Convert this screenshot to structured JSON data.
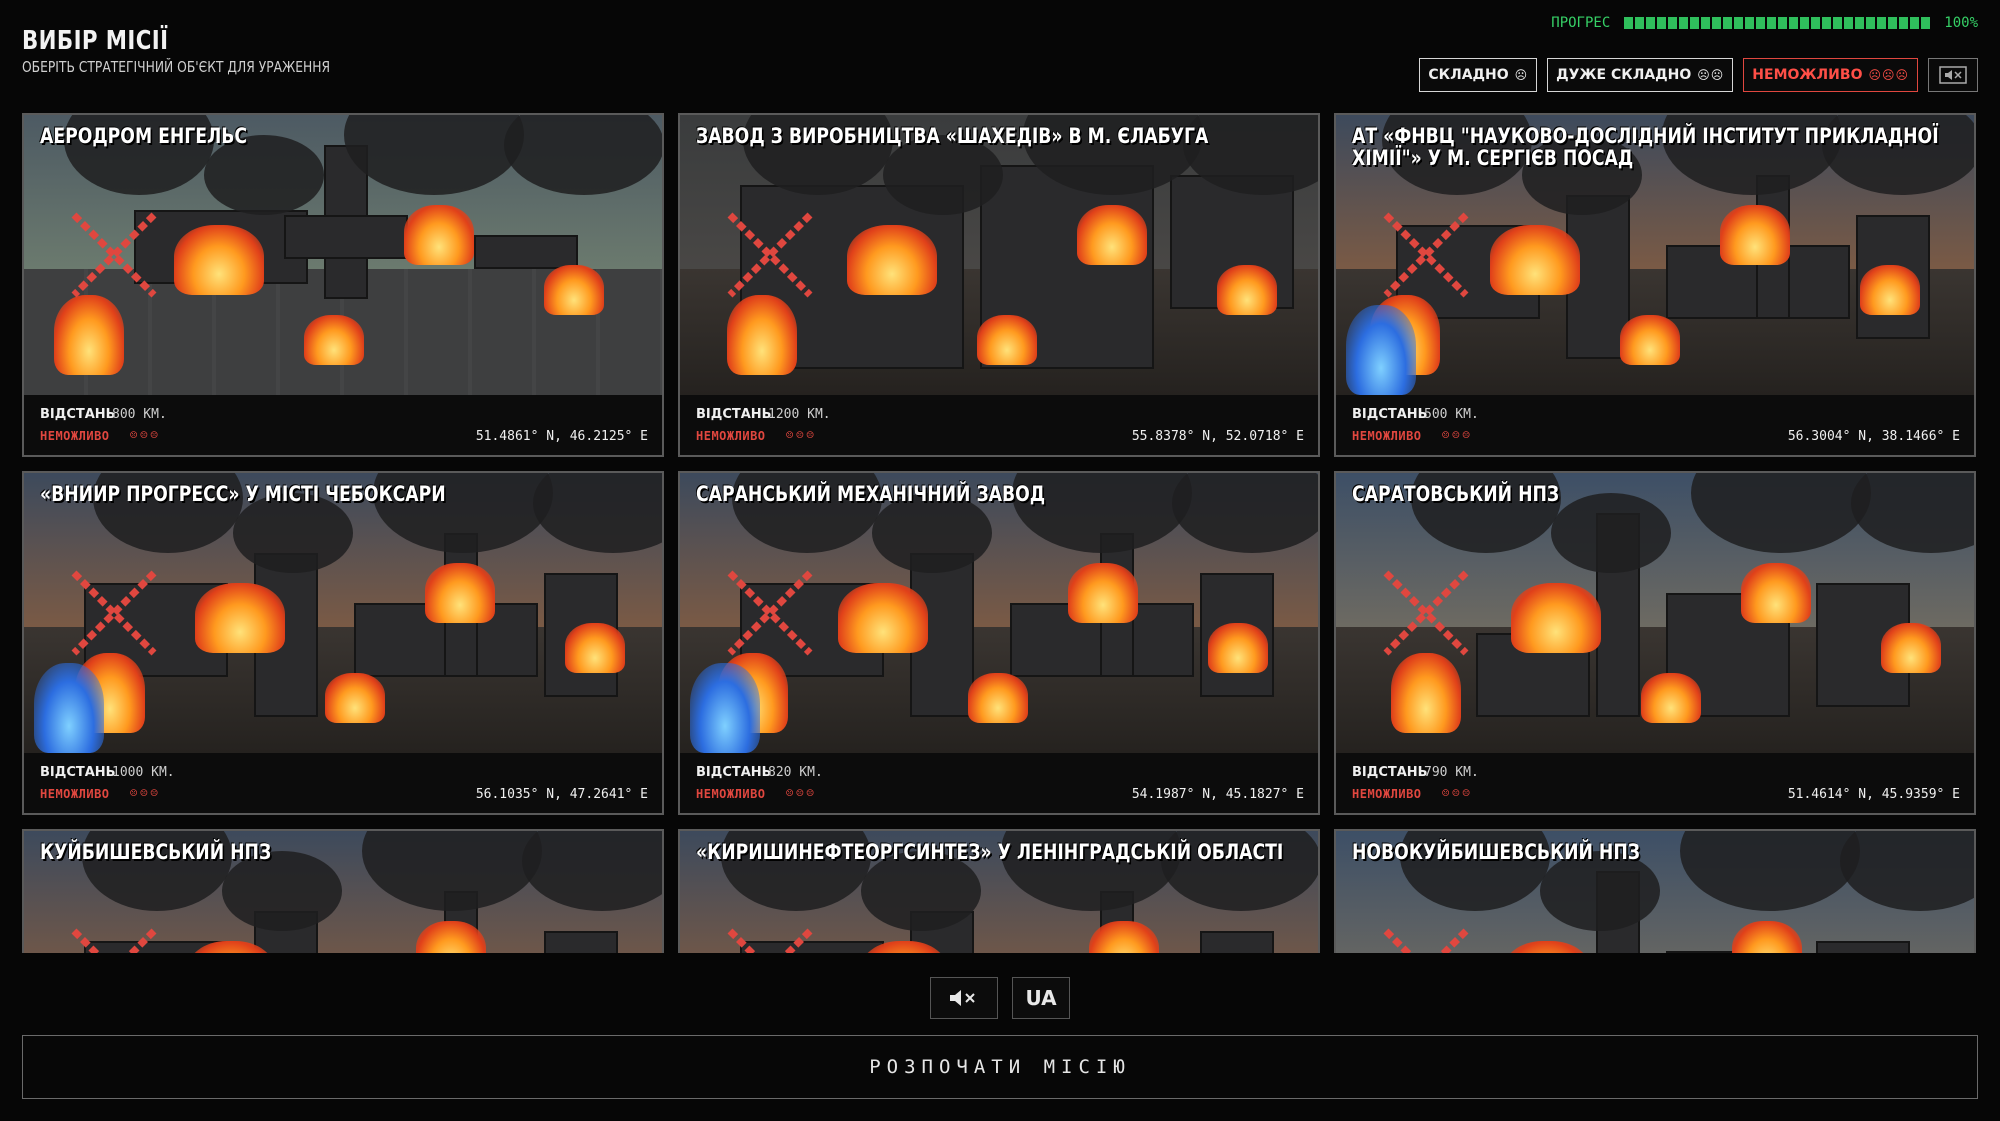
{
  "header": {
    "title": "ВИБІР МІСІЇ",
    "subtitle": "ОБЕРІТЬ СТРАТЕГІЧНИЙ ОБ'ЄКТ ДЛЯ УРАЖЕННЯ",
    "progress_label": "ПРОГРЕС",
    "progress_value": "100%",
    "progress_fraction": 1.0
  },
  "difficulties": [
    {
      "label": "СКЛАДНО",
      "skulls": "☹",
      "active": false
    },
    {
      "label": "ДУЖЕ СКЛАДНО",
      "skulls": "☹☹",
      "active": false
    },
    {
      "label": "НЕМОЖЛИВО",
      "skulls": "☹☹☹",
      "active": true
    }
  ],
  "mute_toggle_icon": "speaker-muted-icon",
  "missions": [
    {
      "title": "АЕРОДРОМ ЕНГЕЛЬС",
      "distance_label": "ВІДСТАНЬ",
      "distance": "800 КМ.",
      "difficulty": "НЕМОЖЛИВО",
      "skulls": "☹☹☹",
      "coords": "51.4861° N, 46.2125° E",
      "scene": "airfield"
    },
    {
      "title": "ЗАВОД З ВИРОБНИЦТВА «ШАХЕДІВ» В М. ЄЛАБУГА",
      "distance_label": "ВІДСТАНЬ",
      "distance": "1200 КМ.",
      "difficulty": "НЕМОЖЛИВО",
      "skulls": "☹☹☹",
      "coords": "55.8378° N, 52.0718° E",
      "scene": "factory"
    },
    {
      "title": "АТ «ФНВЦ \"НАУКОВО-ДОСЛІДНИЙ ІНСТИТУТ ПРИКЛАДНОЇ ХІМІЇ\"» У М. СЕРГІЄВ ПОСАД",
      "distance_label": "ВІДСТАНЬ",
      "distance": "500 КМ.",
      "difficulty": "НЕМОЖЛИВО",
      "skulls": "☹☹☹",
      "coords": "56.3004° N, 38.1466° E",
      "scene": "refinery"
    },
    {
      "title": "«ВНИИР ПРОГРЕСС» У МІСТІ ЧЕБОКСАРИ",
      "distance_label": "ВІДСТАНЬ",
      "distance": "1000 КМ.",
      "difficulty": "НЕМОЖЛИВО",
      "skulls": "☹☹☹",
      "coords": "56.1035° N, 47.2641° E",
      "scene": "refinery"
    },
    {
      "title": "САРАНСЬКИЙ МЕХАНІЧНИЙ ЗАВОД",
      "distance_label": "ВІДСТАНЬ",
      "distance": "820 КМ.",
      "difficulty": "НЕМОЖЛИВО",
      "skulls": "☹☹☹",
      "coords": "54.1987° N, 45.1827° E",
      "scene": "refinery"
    },
    {
      "title": "САРАТОВСЬКИЙ НПЗ",
      "distance_label": "ВІДСТАНЬ",
      "distance": "790 КМ.",
      "difficulty": "НЕМОЖЛИВО",
      "skulls": "☹☹☹",
      "coords": "51.4614° N, 45.9359° E",
      "scene": "tower"
    },
    {
      "title": "КУЙБИШЕВСЬКИЙ НПЗ",
      "scene": "refinery"
    },
    {
      "title": "«КИРИШИНЕФТЕОРГСИНТЕЗ» У ЛЕНІНГРАДСЬКІЙ ОБЛАСТІ",
      "scene": "refinery"
    },
    {
      "title": "НОВОКУЙБИШЕВСЬКИЙ НПЗ",
      "scene": "tower"
    }
  ],
  "controls": {
    "mute_icon": "speaker-muted-icon",
    "language": "UA"
  },
  "start_button": "РОЗПОЧАТИ МІСІЮ",
  "colors": {
    "accent_red": "#e0473f",
    "progress_green": "#2fbf5c",
    "fire": "#ff7a1a",
    "background": "#060606"
  }
}
